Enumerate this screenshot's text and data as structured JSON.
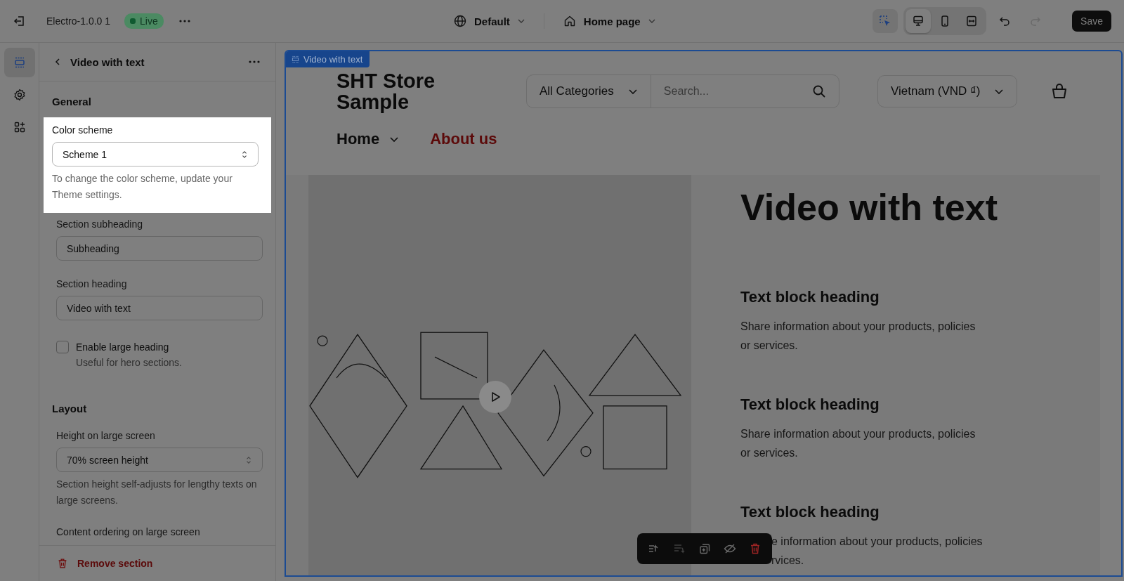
{
  "topbar": {
    "theme_name": "Electro-1.0.0 1",
    "status": "Live",
    "language": "Default",
    "page": "Home page",
    "save": "Save",
    "inspector": {
      "on": true
    },
    "view_modes": [
      {
        "kind": "desktop",
        "selected": true
      },
      {
        "kind": "mobile",
        "selected": false
      },
      {
        "kind": "fullwidth",
        "selected": false
      }
    ],
    "history": [
      {
        "kind": "undo",
        "disabled": false
      },
      {
        "kind": "redo",
        "disabled": true
      }
    ]
  },
  "rail": [
    {
      "kind": "sections",
      "selected": true
    },
    {
      "kind": "settings",
      "selected": false
    },
    {
      "kind": "apps",
      "selected": false
    }
  ],
  "panel": {
    "title": "Video with text",
    "items": [
      {
        "kind": "heading",
        "text": "General"
      },
      {
        "kind": "select",
        "label": "Color scheme",
        "value": "Scheme 1",
        "help": "To change the color scheme, update your Theme settings.",
        "highlighted": true
      },
      {
        "kind": "text",
        "label": "Section subheading",
        "value": "Subheading",
        "highlighted": false
      },
      {
        "kind": "text",
        "label": "Section heading",
        "value": "Video with text",
        "highlighted": false
      },
      {
        "kind": "checkbox",
        "label": "Enable large heading",
        "help": "Useful for hero sections.",
        "checked": false,
        "highlighted": false
      },
      {
        "kind": "heading",
        "text": "Layout"
      },
      {
        "kind": "select",
        "label": "Height on large screen",
        "value": "70% screen height",
        "help": "Section height self-adjusts for lengthy texts on large screens.",
        "highlighted": false
      },
      {
        "kind": "label",
        "label": "Content ordering on large screen",
        "highlighted": false
      }
    ],
    "footer_action": "Remove section"
  },
  "preview": {
    "section_label": "Video with text",
    "store_name": "SHT Store Sample",
    "category": "All Categories",
    "search_placeholder": "Search...",
    "currency": "Vietnam (VND ₫)",
    "nav": [
      {
        "label": "Home",
        "dropdown": true,
        "selected": false
      },
      {
        "label": "About us",
        "dropdown": false,
        "selected": true
      }
    ],
    "heading": "Video with text",
    "blocks": [
      {
        "heading": "Text block heading",
        "lines": [
          "Share information about your products, policies",
          "or services."
        ],
        "clipped": false
      },
      {
        "heading": "Text block heading",
        "lines": [
          "Share information about your products, policies",
          "or services."
        ],
        "clipped": false
      },
      {
        "heading": "Text block heading",
        "lines": [
          "e information about your products, policies",
          "rvices."
        ],
        "clipped": true
      }
    ],
    "toolbar": [
      {
        "kind": "move-up",
        "disabled": false
      },
      {
        "kind": "move-down",
        "disabled": true
      },
      {
        "kind": "duplicate",
        "disabled": false
      },
      {
        "kind": "hide",
        "disabled": false
      },
      {
        "kind": "delete",
        "disabled": false
      }
    ]
  }
}
